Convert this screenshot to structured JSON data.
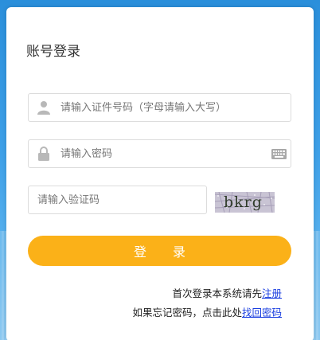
{
  "login": {
    "title": "账号登录",
    "id_placeholder": "请输入证件号码（字母请输入大写）",
    "password_placeholder": "请输入密码",
    "captcha_placeholder": "请输入验证码",
    "captcha_text": "bkrg",
    "submit_label": "登 录"
  },
  "links": {
    "first_login_text": "首次登录本系统请先",
    "register_label": "注册",
    "forgot_text": "如果忘记密码，点击此处",
    "recover_label": "找回密码"
  },
  "colors": {
    "accent": "#fbb118",
    "link": "#1a3ee0",
    "background": "#3ea0e8"
  },
  "icons": {
    "id_field": "user-icon",
    "password_field": "lock-icon",
    "keyboard": "keyboard-icon"
  }
}
